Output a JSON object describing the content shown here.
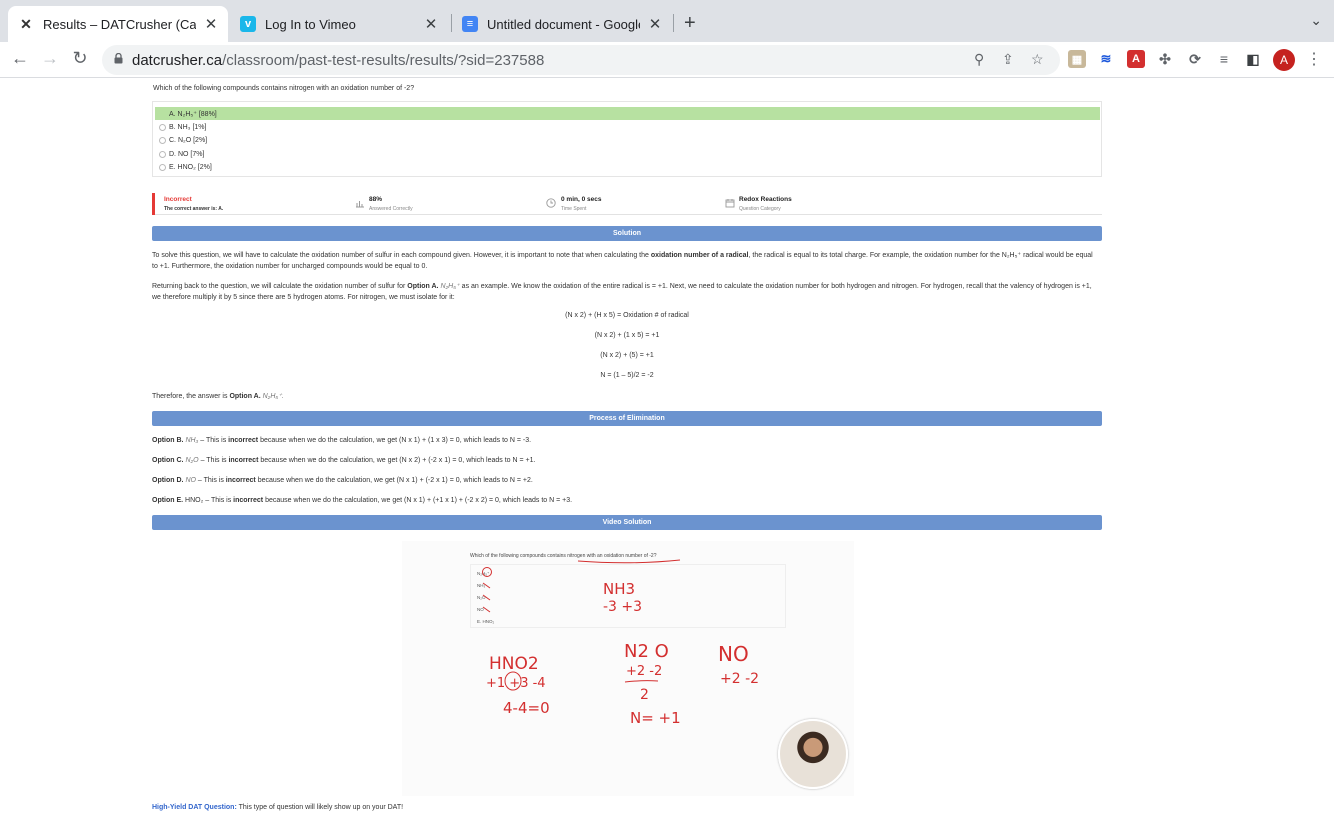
{
  "browser": {
    "tabs": [
      {
        "title": "Results – DATCrusher (Canada",
        "active": true,
        "icon": "datcrusher-x-icon"
      },
      {
        "title": "Log In to Vimeo",
        "active": false,
        "icon": "vimeo-icon"
      },
      {
        "title": "Untitled document - Google Do",
        "active": false,
        "icon": "google-docs-icon"
      }
    ],
    "url_domain": "datcrusher.ca",
    "url_path": "/classroom/past-test-results/results/?sid=237588",
    "profile_initial": "A",
    "colors": {
      "tabbar": "#dee1e6",
      "accent_red": "#c5221f"
    }
  },
  "question": {
    "text": "Which of the following compounds contains nitrogen with an oxidation number of -2?",
    "options": [
      {
        "label": "A. N₂H₅⁺ [88%]",
        "correct": true
      },
      {
        "label": "B. NH₃ [1%]",
        "correct": false
      },
      {
        "label": "C. N₂O [2%]",
        "correct": false
      },
      {
        "label": "D. NO [7%]",
        "correct": false
      },
      {
        "label": "E. HNO₂ [2%]",
        "correct": false
      }
    ]
  },
  "stats": {
    "result": "Incorrect",
    "result_detail": "The correct answer is: A.",
    "percent": "88%",
    "percent_label": "Answered Correctly",
    "time": "0 min, 0 secs",
    "time_label": "Time Spent",
    "category": "Redox Reactions",
    "category_label": "Question Category"
  },
  "solution": {
    "heading": "Solution",
    "p1a": "To solve this question, we will have to calculate the oxidation number of sulfur in each compound given. However, it is important to note that when calculating the ",
    "p1b": "oxidation number of a radical",
    "p1c": ", the radical is equal to its total charge. For example, the oxidation number for the N₂H₅⁺ radical would be equal to +1. Furthermore, the oxidation number for uncharged compounds would be equal to 0.",
    "p2a": "Returning back to the question, we will calculate the oxidation number of sulfur for ",
    "p2b": "Option A.",
    "p2c": " N₂H₅⁺",
    "p2d": " as an example. We know the oxidation of the entire radical is = +1. Next, we need to calculate the oxidation number for both hydrogen and nitrogen. For hydrogen, recall that the valency of hydrogen is +1, we therefore multiply it by 5 since there are 5 hydrogen atoms. For nitrogen, we must isolate for it:",
    "eq1": "(N x 2) + (H x 5) = Oxidation # of radical",
    "eq2": "(N x 2) + (1 x 5) = +1",
    "eq3": "(N x 2) + (5) = +1",
    "eq4": "N = (1 – 5)/2 = -2",
    "conclusion_a": "Therefore, the answer is ",
    "conclusion_b": "Option A.",
    "conclusion_c": " N₂H₅⁺."
  },
  "elimination": {
    "heading": "Process of Elimination",
    "items": [
      {
        "opt": "Option B.",
        "formula": " NH₃",
        "a": " – This is ",
        "b": "incorrect",
        "c": " because when we do the calculation, we get (N x 1) + (1 x 3) = 0, which leads to N = -3."
      },
      {
        "opt": "Option C.",
        "formula": " N₂O",
        "a": " – This is ",
        "b": "incorrect",
        "c": " because when we do the calculation, we get (N x 2) + (-2 x 1) = 0, which leads to N = +1."
      },
      {
        "opt": "Option D.",
        "formula": " NO",
        "a": " – This is ",
        "b": "incorrect",
        "c": " because when we do the calculation, we get (N x 1) + (-2 x 1) = 0, which leads to N = +2."
      },
      {
        "opt": "Option E.",
        "formula": " HNO₂",
        "a": " – This is ",
        "b": "incorrect",
        "c": " because when we do the calculation, we get (N x 1) + (+1 x 1) + (-2 x 2) = 0, which leads to N = +3."
      }
    ]
  },
  "video": {
    "heading": "Video Solution",
    "question": "Which of the following compounds contains nitrogen with an oxidation number of -2?",
    "options": [
      "N₂H₅⁺",
      "NH₃",
      "N₂O",
      "NO",
      "E. HNO₂"
    ],
    "ink": {
      "nh3_formula": "NH3",
      "nh3_values": "-3 +3",
      "hno2_formula": "HNO2",
      "hno2_values": "+1 +3 -4",
      "hno2_sum": "4-4=0",
      "n2o_formula": "N2 O",
      "n2o_values": "+2 -2",
      "n2o_divisor": "2",
      "n2o_result": "N= +1",
      "no_formula": "NO",
      "no_values": "+2 -2"
    }
  },
  "footer": {
    "label": "High-Yield DAT Question:",
    "text": " This type of question will likely show up on your DAT!"
  }
}
